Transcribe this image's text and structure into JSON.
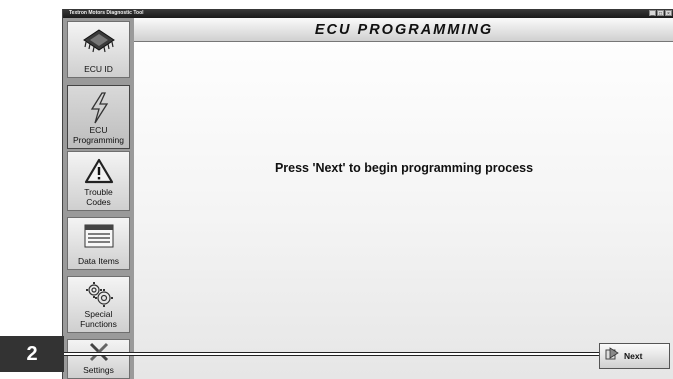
{
  "window": {
    "title": "Textron Motors Diagnostic Tool",
    "controls": [
      "_",
      "□",
      "×"
    ]
  },
  "sidebar": {
    "items": [
      {
        "label": "ECU ID",
        "icon": "chip-icon",
        "selected": false
      },
      {
        "label": "ECU Programming",
        "icon": "lightning-icon",
        "selected": true
      },
      {
        "label": "Trouble Codes",
        "icon": "warning-icon",
        "selected": false
      },
      {
        "label": "Data Items",
        "icon": "data-window-icon",
        "selected": false
      },
      {
        "label": "Special Functions",
        "icon": "gears-icon",
        "selected": false
      },
      {
        "label": "Settings",
        "icon": "tools-icon",
        "selected": false
      }
    ]
  },
  "main": {
    "header": "ECU PROGRAMMING",
    "message": "Press 'Next' to begin programming process",
    "next_button": {
      "label": "Next",
      "icon": "arrow-next-icon"
    }
  },
  "callout": {
    "number": "2"
  }
}
